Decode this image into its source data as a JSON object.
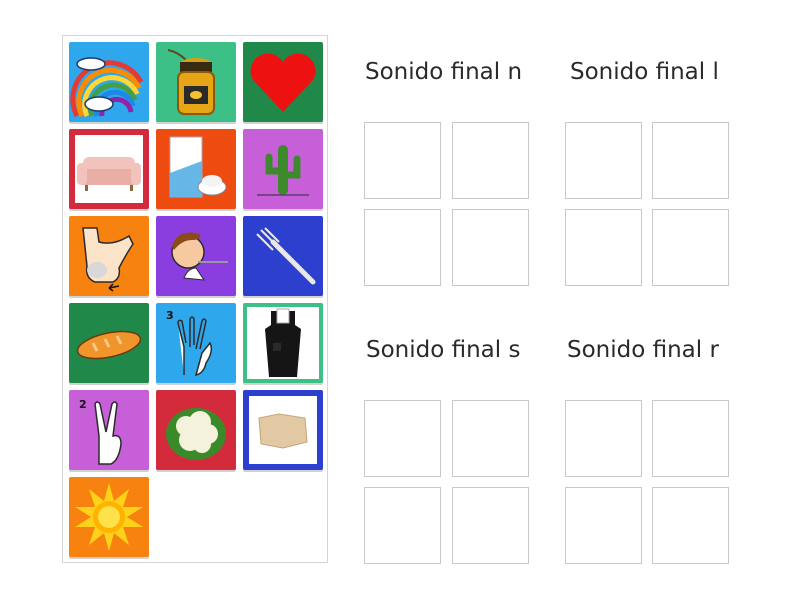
{
  "palette": {
    "tiles": [
      {
        "picture": "rainbow",
        "background": "#2fa7ec"
      },
      {
        "picture": "honey-jar",
        "background": "#3cc088"
      },
      {
        "picture": "heart",
        "background": "#20894a"
      },
      {
        "picture": "sofa",
        "background": "#d32b3b"
      },
      {
        "picture": "flour",
        "background": "#ee4b11"
      },
      {
        "picture": "cactus",
        "background": "#c65fd8"
      },
      {
        "picture": "foot",
        "background": "#f7820f"
      },
      {
        "picture": "boy-eating",
        "background": "#8a3ee0"
      },
      {
        "picture": "fork",
        "background": "#2d3fcf"
      },
      {
        "picture": "bread",
        "background": "#20894a"
      },
      {
        "picture": "three-fingers",
        "background": "#2fa7ec",
        "badge": "3"
      },
      {
        "picture": "apron",
        "background": "#3cc088"
      },
      {
        "picture": "two-fingers",
        "background": "#c65fd8",
        "badge": "2"
      },
      {
        "picture": "cauliflower",
        "background": "#d32b3b"
      },
      {
        "picture": "paper",
        "background": "#2d3fcf"
      },
      {
        "picture": "sun",
        "background": "#f7820f"
      }
    ]
  },
  "groups": [
    {
      "title": "Sonido final n"
    },
    {
      "title": "Sonido final l"
    },
    {
      "title": "Sonido final s"
    },
    {
      "title": "Sonido final r"
    }
  ]
}
